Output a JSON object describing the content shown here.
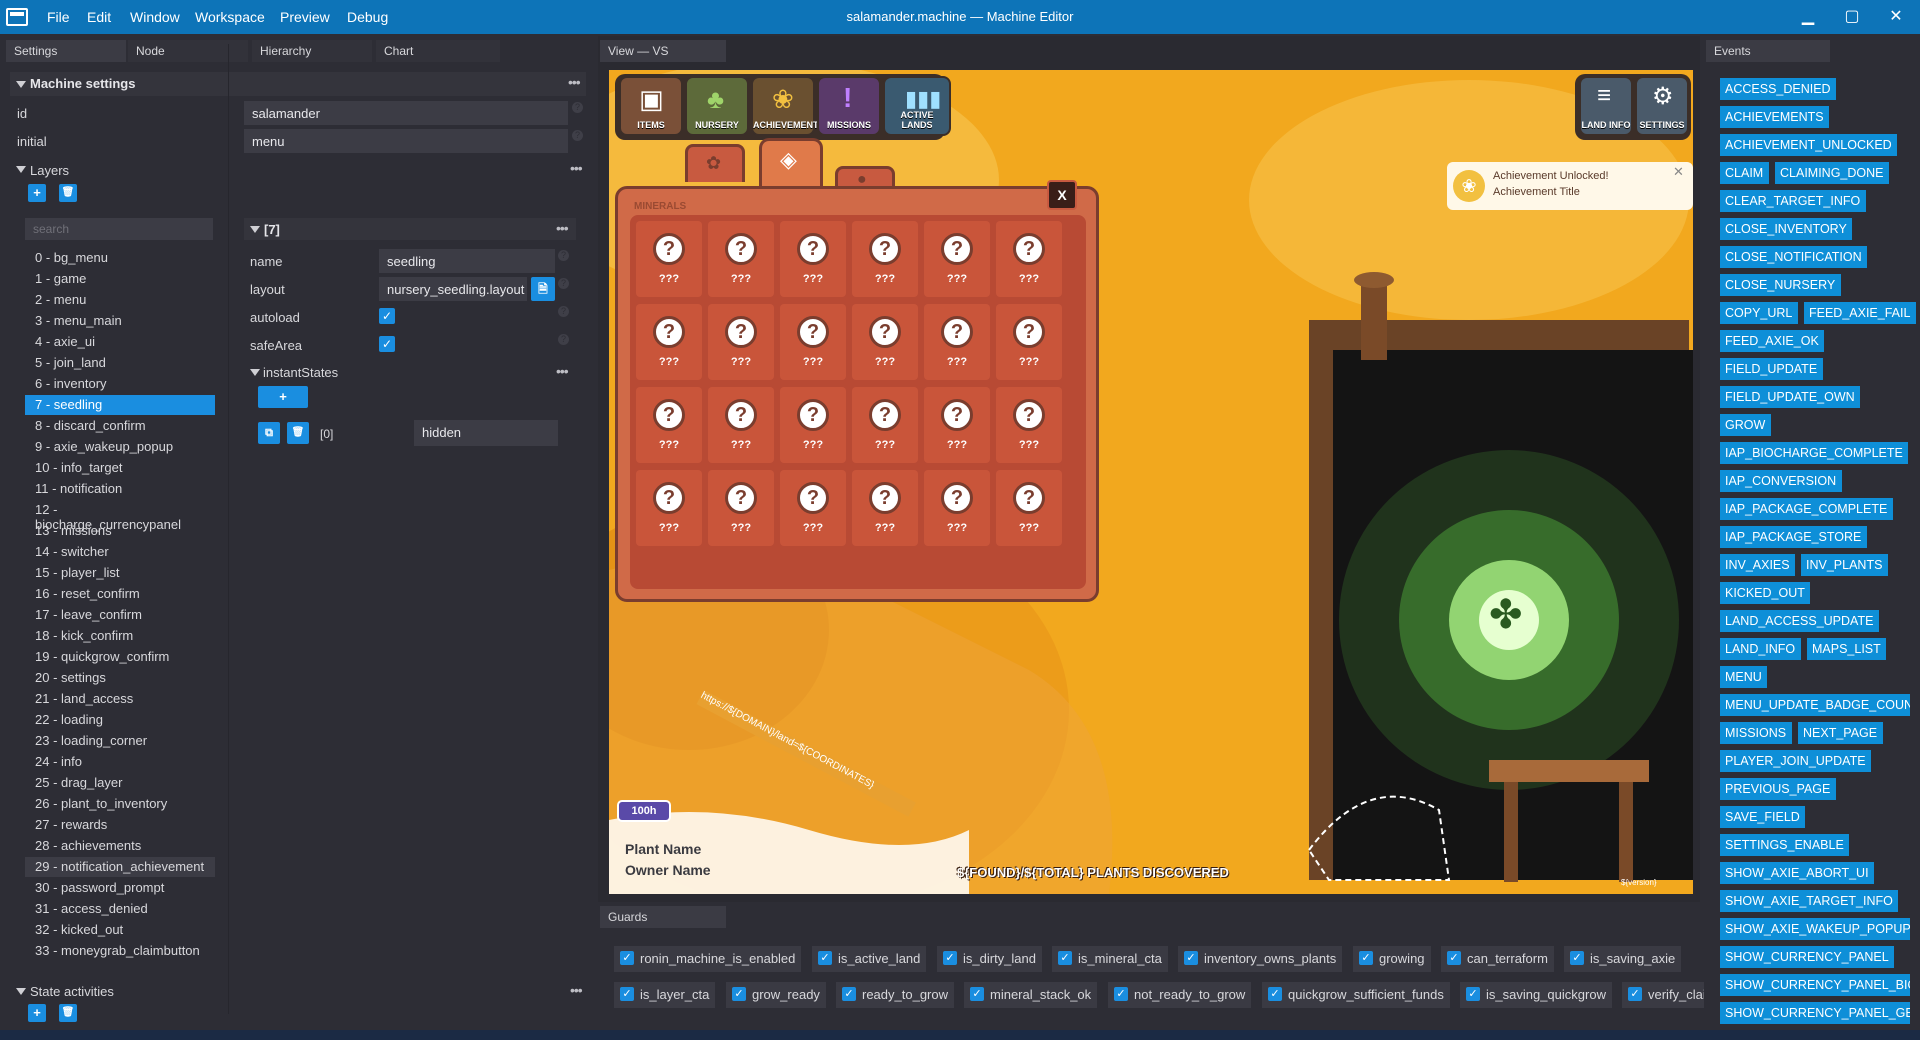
{
  "window": {
    "title": "salamander.machine — Machine Editor",
    "menus": [
      "File",
      "Edit",
      "Window",
      "Workspace",
      "Preview",
      "Debug"
    ],
    "minimize": "▁",
    "maximize": "▢",
    "close": "✕"
  },
  "left_tabs": [
    "Settings",
    "Node",
    "Hierarchy",
    "Chart"
  ],
  "machine_settings": {
    "header": "Machine settings",
    "id_label": "id",
    "id_value": "salamander",
    "initial_label": "initial",
    "initial_value": "menu"
  },
  "layers": {
    "header": "Layers",
    "search_placeholder": "search",
    "items": [
      "0 - bg_menu",
      "1 - game",
      "2 - menu",
      "3 - menu_main",
      "4 - axie_ui",
      "5 - join_land",
      "6 - inventory",
      "7 - seedling",
      "8 - discard_confirm",
      "9 - axie_wakeup_popup",
      "10 - info_target",
      "11 - notification",
      "12 - biocharge_currencypanel",
      "13 - missions",
      "14 - switcher",
      "15 - player_list",
      "16 - reset_confirm",
      "17 - leave_confirm",
      "18 - kick_confirm",
      "19 - quickgrow_confirm",
      "20 - settings",
      "21 - land_access",
      "22 - loading",
      "23 - loading_corner",
      "24 - info",
      "25 - drag_layer",
      "26 - plant_to_inventory",
      "27 - rewards",
      "28 - achievements",
      "29 - notification_achievement",
      "30 - password_prompt",
      "31 - access_denied",
      "32 - kicked_out",
      "33 - moneygrab_claimbutton"
    ],
    "selected": 7,
    "hovered": 29
  },
  "layer_detail": {
    "header": "[7]",
    "name_label": "name",
    "name_value": "seedling",
    "layout_label": "layout",
    "layout_value": "nursery_seedling.layout",
    "autoload_label": "autoload",
    "safearea_label": "safeArea",
    "instant_label": "instantStates",
    "state_index": "[0]",
    "state_value": "hidden"
  },
  "state_activities": {
    "header": "State activities"
  },
  "view": {
    "tab": "View — VS"
  },
  "game": {
    "hud_left": [
      "ITEMS",
      "NURSERY",
      "ACHIEVEMENTS",
      "MISSIONS",
      "ACTIVE LANDS"
    ],
    "hud_right": [
      "LAND INFO",
      "SETTINGS"
    ],
    "panel_title": "MINERALS",
    "close": "X",
    "cell_label": "???",
    "notif_line1": "Achievement Unlocked!",
    "notif_line2": "Achievement Title",
    "url_text": "https://${DOMAIN}/land=${COORDINATES}",
    "badge": "100h",
    "plant_name": "Plant Name",
    "owner_name": "Owner Name",
    "discovered": "${FOUND}/${TOTAL} PLANTS DISCOVERED",
    "version": "${version}"
  },
  "guards": {
    "tab": "Guards",
    "row1": [
      "ronin_machine_is_enabled",
      "is_active_land",
      "is_dirty_land",
      "is_mineral_cta",
      "inventory_owns_plants",
      "growing",
      "can_terraform",
      "is_saving_axie"
    ],
    "row2": [
      "is_layer_cta",
      "grow_ready",
      "ready_to_grow",
      "mineral_stack_ok",
      "not_ready_to_grow",
      "quickgrow_sufficient_funds",
      "is_saving_quickgrow",
      "verify_claim"
    ]
  },
  "events": {
    "tab": "Events",
    "rows": [
      [
        "ACCESS_DENIED"
      ],
      [
        "ACHIEVEMENTS"
      ],
      [
        "ACHIEVEMENT_UNLOCKED"
      ],
      [
        "CLAIM",
        "CLAIMING_DONE"
      ],
      [
        "CLEAR_TARGET_INFO"
      ],
      [
        "CLOSE_INVENTORY"
      ],
      [
        "CLOSE_NOTIFICATION"
      ],
      [
        "CLOSE_NURSERY"
      ],
      [
        "COPY_URL",
        "FEED_AXIE_FAIL"
      ],
      [
        "FEED_AXIE_OK"
      ],
      [
        "FIELD_UPDATE"
      ],
      [
        "FIELD_UPDATE_OWN"
      ],
      [
        "GROW"
      ],
      [
        "IAP_BIOCHARGE_COMPLETE"
      ],
      [
        "IAP_CONVERSION"
      ],
      [
        "IAP_PACKAGE_COMPLETE"
      ],
      [
        "IAP_PACKAGE_STORE"
      ],
      [
        "INV_AXIES",
        "INV_PLANTS"
      ],
      [
        "KICKED_OUT"
      ],
      [
        "LAND_ACCESS_UPDATE"
      ],
      [
        "LAND_INFO",
        "MAPS_LIST"
      ],
      [
        "MENU"
      ],
      [
        "MENU_UPDATE_BADGE_COUN"
      ],
      [
        "MISSIONS",
        "NEXT_PAGE"
      ],
      [
        "PLAYER_JOIN_UPDATE"
      ],
      [
        "PREVIOUS_PAGE"
      ],
      [
        "SAVE_FIELD"
      ],
      [
        "SETTINGS_ENABLE"
      ],
      [
        "SHOW_AXIE_ABORT_UI"
      ],
      [
        "SHOW_AXIE_TARGET_INFO"
      ],
      [
        "SHOW_AXIE_WAKEUP_POPUP"
      ],
      [
        "SHOW_CURRENCY_PANEL"
      ],
      [
        "SHOW_CURRENCY_PANEL_BIO"
      ],
      [
        "SHOW_CURRENCY_PANEL_GEN"
      ]
    ]
  }
}
